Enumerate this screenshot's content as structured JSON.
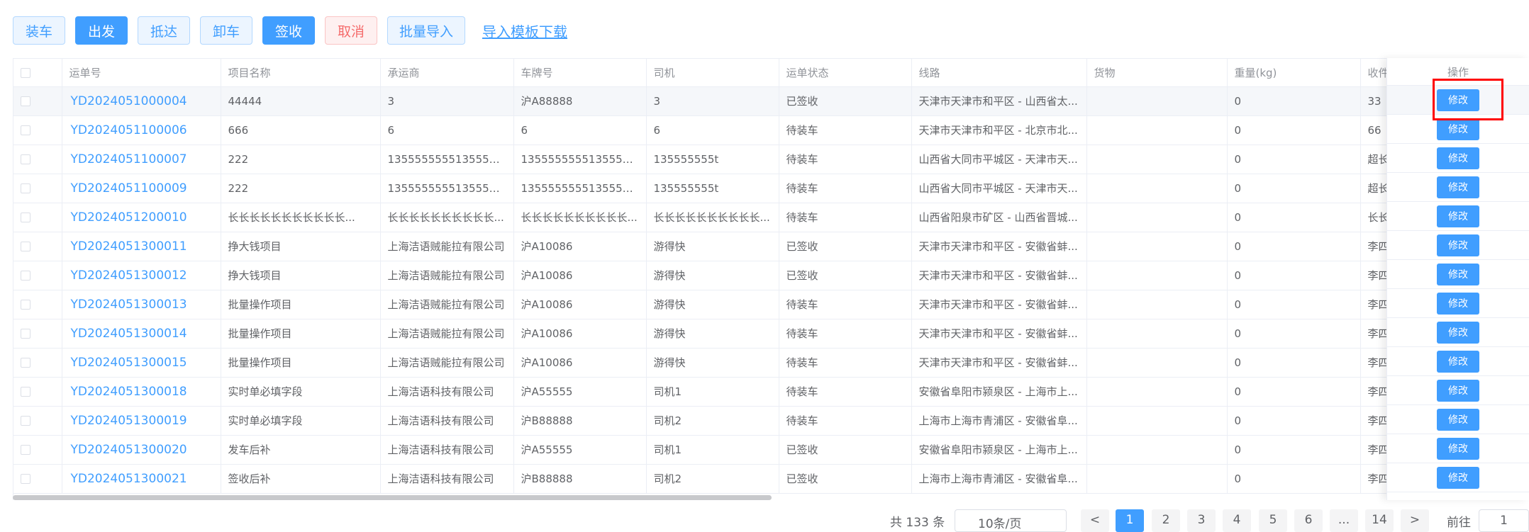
{
  "toolbar": {
    "buttons": [
      "装车",
      "出发",
      "抵达",
      "卸车",
      "签收",
      "取消",
      "批量导入"
    ],
    "link": "导入模板下载"
  },
  "table": {
    "columns": [
      "运单号",
      "项目名称",
      "承运商",
      "车牌号",
      "司机",
      "运单状态",
      "线路",
      "货物",
      "重量(kg)",
      "收件"
    ],
    "action_header": "操作",
    "action_label": "修改",
    "rows": [
      [
        "YD2024051000004",
        "44444",
        "3",
        "沪A88888",
        "3",
        "已签收",
        "天津市天津市和平区 - 山西省太...",
        "",
        "0",
        "33"
      ],
      [
        "YD2024051100006",
        "666",
        "6",
        "6",
        "6",
        "待装车",
        "天津市天津市和平区 - 北京市北...",
        "",
        "0",
        "66"
      ],
      [
        "YD2024051100007",
        "222",
        "13555555551355555...",
        "13555555551355555...",
        "135555555t",
        "待装车",
        "山西省大同市平城区 - 天津市天...",
        "",
        "0",
        "超长"
      ],
      [
        "YD2024051100009",
        "222",
        "13555555551355555...",
        "13555555551355555...",
        "135555555t",
        "待装车",
        "山西省大同市平城区 - 天津市天...",
        "",
        "0",
        "超长"
      ],
      [
        "YD2024051200010",
        "长长长长长长长长长长长...",
        "长长长长长长长长长长...",
        "长长长长长长长长长长...",
        "长长长长长长长长长长...",
        "待装车",
        "山西省阳泉市矿区 - 山西省晋城...",
        "",
        "0",
        "长长"
      ],
      [
        "YD2024051300011",
        "挣大钱项目",
        "上海洁语贼能拉有限公司",
        "沪A10086",
        "游得快",
        "已签收",
        "天津市天津市和平区 - 安徽省蚌...",
        "",
        "0",
        "李四"
      ],
      [
        "YD2024051300012",
        "挣大钱项目",
        "上海洁语贼能拉有限公司",
        "沪A10086",
        "游得快",
        "已签收",
        "天津市天津市和平区 - 安徽省蚌...",
        "",
        "0",
        "李四"
      ],
      [
        "YD2024051300013",
        "批量操作项目",
        "上海洁语贼能拉有限公司",
        "沪A10086",
        "游得快",
        "待装车",
        "天津市天津市和平区 - 安徽省蚌...",
        "",
        "0",
        "李四"
      ],
      [
        "YD2024051300014",
        "批量操作项目",
        "上海洁语贼能拉有限公司",
        "沪A10086",
        "游得快",
        "待装车",
        "天津市天津市和平区 - 安徽省蚌...",
        "",
        "0",
        "李四"
      ],
      [
        "YD2024051300015",
        "批量操作项目",
        "上海洁语贼能拉有限公司",
        "沪A10086",
        "游得快",
        "待装车",
        "天津市天津市和平区 - 安徽省蚌...",
        "",
        "0",
        "李四"
      ],
      [
        "YD2024051300018",
        "实时单必填字段",
        "上海洁语科技有限公司",
        "沪A55555",
        "司机1",
        "待装车",
        "安徽省阜阳市颍泉区 - 上海市上...",
        "",
        "0",
        "李四"
      ],
      [
        "YD2024051300019",
        "实时单必填字段",
        "上海洁语科技有限公司",
        "沪B88888",
        "司机2",
        "待装车",
        "上海市上海市青浦区 - 安徽省阜...",
        "",
        "0",
        "李四"
      ],
      [
        "YD2024051300020",
        "发车后补",
        "上海洁语科技有限公司",
        "沪A55555",
        "司机1",
        "已签收",
        "安徽省阜阳市颍泉区 - 上海市上...",
        "",
        "0",
        "李四"
      ],
      [
        "YD2024051300021",
        "签收后补",
        "上海洁语科技有限公司",
        "沪B88888",
        "司机2",
        "已签收",
        "上海市上海市青浦区 - 安徽省阜...",
        "",
        "0",
        "李四"
      ]
    ]
  },
  "pagination": {
    "total": "共 133 条",
    "page_size": "10条/页",
    "pages": [
      "<",
      "1",
      "2",
      "3",
      "4",
      "5",
      "6",
      "...",
      "14",
      ">"
    ],
    "jump_label": "前往",
    "jump_value": "1"
  },
  "colors": {
    "primary": "#409eff",
    "danger": "#f56c6c",
    "highlight": "#ff0000"
  }
}
